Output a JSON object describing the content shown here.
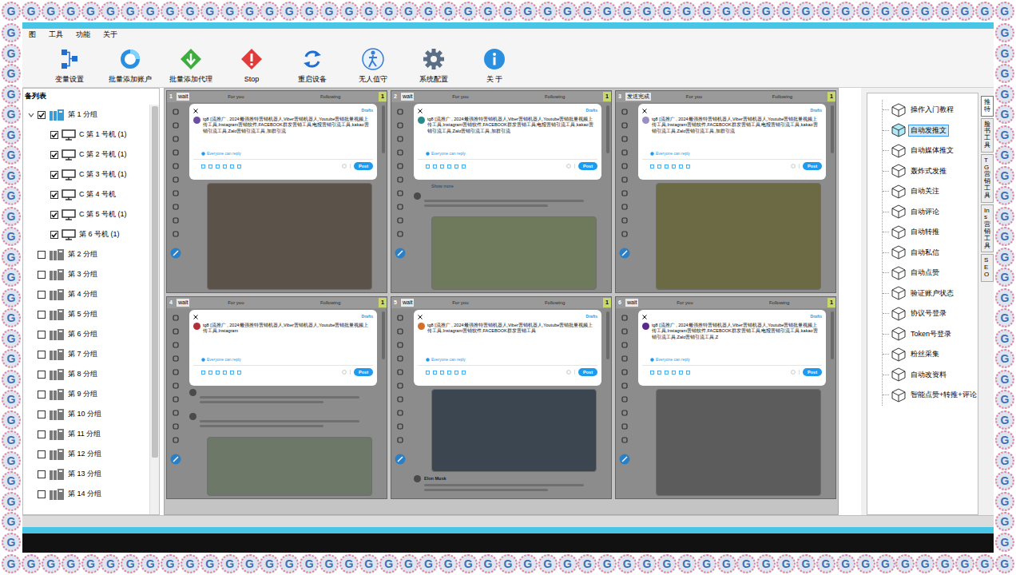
{
  "watermark": "G",
  "window": {
    "menu": [
      "图",
      "工具",
      "功能",
      "关于"
    ]
  },
  "toolbar": [
    {
      "label": "变量设置",
      "kind": "vars"
    },
    {
      "label": "批量添加账户",
      "kind": "accounts"
    },
    {
      "label": "批量添加代理",
      "kind": "proxy"
    },
    {
      "label": "Stop",
      "kind": "stop"
    },
    {
      "label": "重启设备",
      "kind": "restart"
    },
    {
      "label": "无人值守",
      "kind": "unattended"
    },
    {
      "label": "系统配置",
      "kind": "settings"
    },
    {
      "label": "关 于",
      "kind": "about"
    }
  ],
  "device_list": {
    "title": "备列表",
    "groups": [
      {
        "label": "第 1 分组",
        "checked": true,
        "expanded": true,
        "devices": [
          {
            "label": "C 第 1 号机 (1)",
            "checked": true
          },
          {
            "label": "C 第 2 号机 (1)",
            "checked": true
          },
          {
            "label": "C 第 3 号机 (1)",
            "checked": true
          },
          {
            "label": "C 第 4 号机",
            "checked": true
          },
          {
            "label": "C 第 5 号机 (1)",
            "checked": true
          },
          {
            "label": "第 6 号机 (1)",
            "checked": true
          }
        ]
      },
      {
        "label": "第 2 分组",
        "checked": false,
        "expanded": false,
        "devices": []
      },
      {
        "label": "第 3 分组",
        "checked": false,
        "expanded": false,
        "devices": []
      },
      {
        "label": "第 4 分组",
        "checked": false,
        "expanded": false,
        "devices": []
      },
      {
        "label": "第 5 分组",
        "checked": false,
        "expanded": false,
        "devices": []
      },
      {
        "label": "第 6 分组",
        "checked": false,
        "expanded": false,
        "devices": []
      },
      {
        "label": "第 7 分组",
        "checked": false,
        "expanded": false,
        "devices": []
      },
      {
        "label": "第 8 分组",
        "checked": false,
        "expanded": false,
        "devices": []
      },
      {
        "label": "第 9 分组",
        "checked": false,
        "expanded": false,
        "devices": []
      },
      {
        "label": "第 10 分组",
        "checked": false,
        "expanded": false,
        "devices": []
      },
      {
        "label": "第 11 分组",
        "checked": false,
        "expanded": false,
        "devices": []
      },
      {
        "label": "第 12 分组",
        "checked": false,
        "expanded": false,
        "devices": []
      },
      {
        "label": "第 13 分组",
        "checked": false,
        "expanded": false,
        "devices": []
      },
      {
        "label": "第 14 分组",
        "checked": false,
        "expanded": false,
        "devices": []
      }
    ]
  },
  "phones": [
    {
      "index": "1",
      "status": "wait",
      "badge": "1",
      "tabs": [
        "For you",
        "Following"
      ],
      "avatar_color": "#6b4fa0",
      "drafts": "Drafts",
      "compose": "tg8 [流推广 , 2024最强推特营销机器人,Viber营销机器人,Youtube营销批量视频上传工具,Instagram营销软件,FACEBOOK群发营销工具,电报营销引流工具,kakao营销引流工具,Zalo营销引流工具,加群引流",
      "reply": "Everyone can reply",
      "post": "Post",
      "feed": [
        {
          "kind": "media",
          "color": "#5b524a"
        }
      ]
    },
    {
      "index": "2",
      "status": "wait",
      "badge": "1",
      "tabs": [
        "For you",
        "Following"
      ],
      "avatar_color": "#2a8a8a",
      "drafts": "Drafts",
      "compose": "tg8 [流推广 , 2024最强推特营销机器人,Viber营销机器人,Youtube营销批量视频上传工具,Instagram营销软件,FACEBOOK群发营销工具,电报营销引流工具,kakao营销引流工具,Zalo营销引流工具,加群引流",
      "reply": "Everyone can reply",
      "post": "Post",
      "feed": [
        {
          "kind": "line",
          "text": "Show more"
        },
        {
          "kind": "post",
          "author": ""
        },
        {
          "kind": "media",
          "color": "#6f7a5c"
        }
      ]
    },
    {
      "index": "3",
      "status": "发送完成",
      "badge": "1",
      "tabs": [
        "For you",
        "Following"
      ],
      "avatar_color": "#9a8fc0",
      "drafts": "Drafts",
      "compose": "tg8 [流推广 , 2024最强推特营销机器人,Viber营销机器人,Youtube营销批量视频上传工具,Instagram营销软件,FACEBOOK群发营销工具,电报营销引流工具,kakao营销引流工具,Zalo营销引流工具,加群引流",
      "reply": "Everyone can reply",
      "post": "Post",
      "feed": [
        {
          "kind": "media",
          "color": "#6b6a45"
        }
      ]
    },
    {
      "index": "4",
      "status": "wait",
      "badge": "1",
      "tabs": [
        "For you",
        "Following"
      ],
      "avatar_color": "#b0303a",
      "drafts": "Drafts",
      "compose": "tg8 [流推广 , 2024最强推特营销机器人,Viber营销机器人,Youtube营销批量视频上传工具,Instagram",
      "reply": "Everyone can reply",
      "post": "Post",
      "feed": [
        {
          "kind": "post",
          "author": ""
        },
        {
          "kind": "post",
          "author": ""
        },
        {
          "kind": "media",
          "color": "#6d7868"
        }
      ]
    },
    {
      "index": "5",
      "status": "wait",
      "badge": "1",
      "tabs": [
        "For you",
        "Following"
      ],
      "avatar_color": "#d0702a",
      "drafts": "Drafts",
      "compose": "tg8 [流推广 , 2024最强推特营销机器人,Viber营销机器人,Youtube营销批量视频上传工具,Instagram营销软件,FACEBOOK群发营销工具",
      "reply": "Everyone can reply",
      "post": "Post",
      "feed": [
        {
          "kind": "media",
          "color": "#3c4651"
        },
        {
          "kind": "post",
          "author": "Elon Musk"
        }
      ]
    },
    {
      "index": "6",
      "status": "wait",
      "badge": "1",
      "tabs": [
        "For you",
        "Following"
      ],
      "avatar_color": "#5a2a8a",
      "drafts": "Drafts",
      "compose": "tg8 [流推广 , 2024最强推特营销机器人,Viber营销机器人,Youtube营销批量视频上传工具,Instagram营销软件,FACEBOOK群发营销工具,电报营销引流工具,kakao营销引流工具,Zalo营销引流工具,Z",
      "reply": "Everyone can reply",
      "post": "Post",
      "feed": [
        {
          "kind": "media",
          "color": "#5c5c5c"
        }
      ]
    }
  ],
  "features": {
    "items": [
      {
        "label": "操作入门教程",
        "selected": false
      },
      {
        "label": "自动发推文",
        "selected": true
      },
      {
        "label": "自动媒体推文",
        "selected": false
      },
      {
        "label": "轰炸式发推",
        "selected": false
      },
      {
        "label": "自动关注",
        "selected": false
      },
      {
        "label": "自动评论",
        "selected": false
      },
      {
        "label": "自动转推",
        "selected": false
      },
      {
        "label": "自动私信",
        "selected": false
      },
      {
        "label": "自动点赞",
        "selected": false
      },
      {
        "label": "验证账户状态",
        "selected": false
      },
      {
        "label": "协议号登录",
        "selected": false
      },
      {
        "label": "Token号登录",
        "selected": false
      },
      {
        "label": "粉丝采集",
        "selected": false
      },
      {
        "label": "自动改资料",
        "selected": false
      },
      {
        "label": "智能点赞+转推+评论",
        "selected": false
      }
    ],
    "tabs": [
      {
        "label": "推特",
        "selected": true
      },
      {
        "label": "脸书工具",
        "selected": false
      },
      {
        "label": "TG营销工具",
        "selected": false
      },
      {
        "label": "Ins营销工具",
        "selected": false
      },
      {
        "label": "SEO",
        "selected": false
      }
    ]
  }
}
